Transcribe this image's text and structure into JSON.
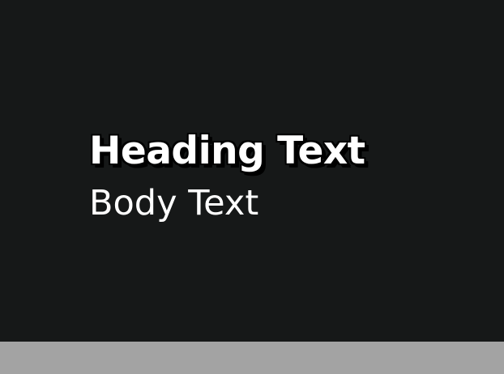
{
  "content": {
    "heading": "Heading Text",
    "body": "Body Text"
  },
  "colors": {
    "background": "#161818",
    "text": "#ffffff",
    "outline": "#000000",
    "bottom_bar": "#a3a3a3"
  }
}
